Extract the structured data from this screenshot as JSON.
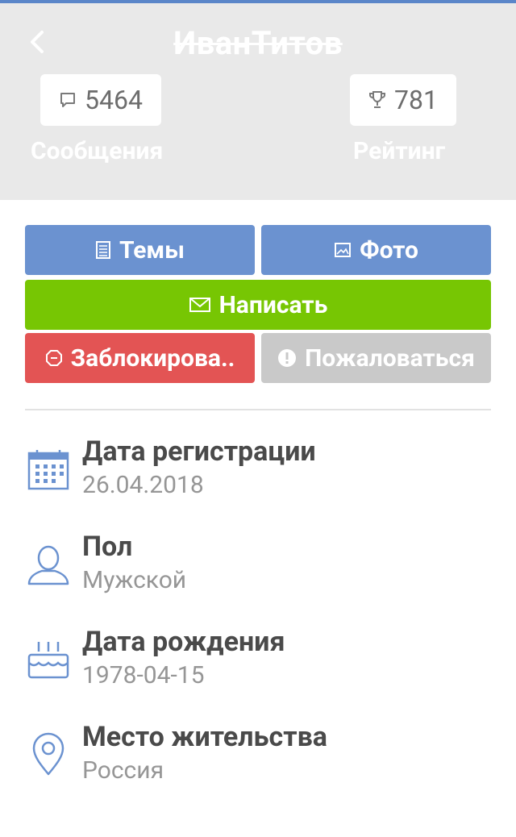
{
  "header": {
    "title": "ИванТитов",
    "messages_count": "5464",
    "messages_label": "Сообщения",
    "rating_count": "781",
    "rating_label": "Рейтинг"
  },
  "actions": {
    "themes": "Темы",
    "photo": "Фото",
    "write": "Написать",
    "block": "Заблокирова..",
    "report": "Пожаловаться"
  },
  "info": {
    "registration_label": "Дата регистрации",
    "registration_value": "26.04.2018",
    "gender_label": "Пол",
    "gender_value": "Мужской",
    "birthday_label": "Дата рождения",
    "birthday_value": "1978-04-15",
    "location_label": "Место жительства",
    "location_value": "Россия"
  },
  "colors": {
    "header_bg": "#e9e9e9",
    "blue_button": "#6b92d0",
    "green_button": "#77c603",
    "red_button": "#e35454",
    "gray_button": "#c9c9c9",
    "icon_blue": "#6b92d0"
  },
  "icons": [
    "back-arrow-icon",
    "chat-bubble-icon",
    "trophy-icon",
    "document-icon",
    "image-icon",
    "envelope-icon",
    "block-octagon-icon",
    "exclamation-circle-icon",
    "calendar-icon",
    "person-icon",
    "birthday-cake-icon",
    "location-pin-icon"
  ]
}
